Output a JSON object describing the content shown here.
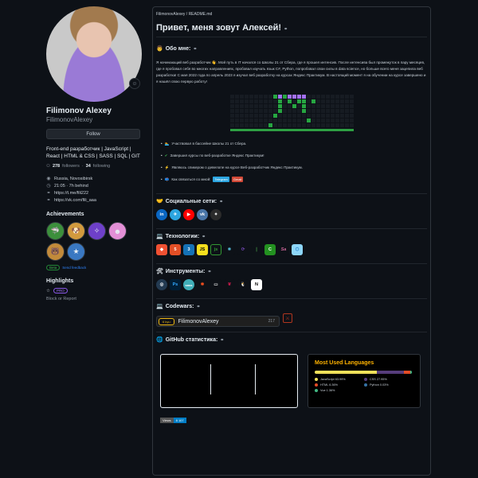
{
  "profile": {
    "fullname": "Filimonov Alexey",
    "login": "FilimonovAlexey",
    "follow_label": "Follow",
    "bio": "Front-end разработчик | JavaScript | React | HTML & CSS | SASS | SQL | GIT",
    "followers_count": "278",
    "followers_label": "followers",
    "following_count": "34",
    "following_label": "following",
    "location": "Russia, Novosibirsk",
    "time": "21:05 · 7h behind",
    "link1": "https://t.me/fili222",
    "link2": "https://vk.com/fili_aaa",
    "achievements_title": "Achievements",
    "beta_label": "Beta",
    "feedback_label": "Send feedback",
    "highlights_title": "Highlights",
    "pro_label": "PRO",
    "block_label": "Block or Report"
  },
  "readme": {
    "breadcrumb": "FilimonovAlexey / README.md",
    "heading": "Привет, меня зовут Алексей!",
    "about_title": "Обо мне:",
    "about_text": "Я начинающий веб разработчик 👋. Мой путь в IT начался со Школы 21 от Сбера, где я прошел интенсив. После интенсива был промежуток в пару месяцев, где я пробовал себя во многих направлениях, пробовал изучать язык C#, Python, попробовал свои силы в data science, но больше всего меня зацепила веб разработка! С мая 2022 года по апрель 2023 я изучал веб разработку на курсах Яндекс Практикум. В настоящий момент я на обучении на курсе завершено и я нашёл свою первую работу!",
    "bullets": [
      "Участвовал в бассейне Школы 21 от Сбера.",
      "Завершил курсы по веб-разработке Яндекс Практикум!",
      "Являюсь спикером о девелопе на курсе Веб-разработчик Яндекс Практикум.",
      "Как связаться со мной:"
    ],
    "contact_badges": [
      "Telegram",
      "Gmail"
    ],
    "social_title": "Социальные сети:",
    "tech_title": "Технологии:",
    "tools_title": "Инструменты:",
    "codewars_title": "Codewars:",
    "codewars_rank": "6 kyu",
    "codewars_user": "FilimonovAlexey",
    "codewars_count": "217",
    "stats_title": "GitHub статистика:",
    "lang_title": "Most Used Languages",
    "languages": [
      {
        "name": "JavaScript",
        "percent": "63.99%",
        "color": "#f1e05a"
      },
      {
        "name": "CSS",
        "percent": "27.95%",
        "color": "#563d7c"
      },
      {
        "name": "HTML",
        "percent": "6.36%",
        "color": "#e34c26"
      },
      {
        "name": "Python",
        "percent": "0.03%",
        "color": "#3572a5"
      },
      {
        "name": "Vue",
        "percent": "1.36%",
        "color": "#41b883"
      }
    ],
    "views_label": "Views",
    "views_count": "8 107"
  },
  "icons": {
    "social": [
      "linkedin-icon",
      "telegram-icon",
      "youtube-icon",
      "vk-icon",
      "star-icon"
    ],
    "tech": [
      "git-icon",
      "html5-icon",
      "css3-icon",
      "javascript-icon",
      "nodejs-icon",
      "react-icon",
      "redux-icon",
      "mongodb-icon",
      "csharp-icon",
      "sass-icon",
      "webpack-icon"
    ],
    "tools": [
      "davinci-icon",
      "photoshop-icon",
      "sass-tool-icon",
      "figma-icon",
      "bash-icon",
      "raspberry-icon",
      "linux-icon",
      "notion-icon"
    ]
  }
}
